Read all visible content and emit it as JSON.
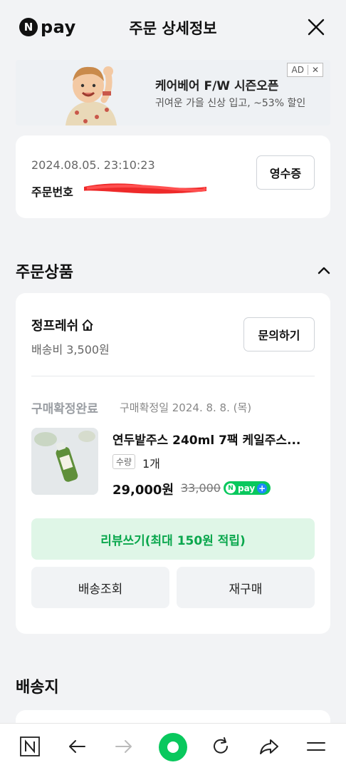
{
  "header": {
    "logo_letter": "N",
    "logo_text": "pay",
    "title": "주문 상세정보"
  },
  "ad": {
    "title": "케어베어 F/W 시즌오픈",
    "subtitle": "귀여운 가을 신상 입고, ~53% 할인",
    "badge": "AD",
    "close": "✕"
  },
  "order": {
    "datetime": "2024.08.05. 23:10:23",
    "number_label": "주문번호",
    "receipt_button": "영수증"
  },
  "ordered_section": {
    "title": "주문상품"
  },
  "seller": {
    "name": "정프레쉬",
    "shipping_fee": "배송비 3,500원",
    "inquiry_button": "문의하기"
  },
  "item": {
    "status": "구매확정완료",
    "status_date": "구매확정일 2024. 8. 8. (목)",
    "name": "연두밭주스 240ml 7팩 케일주스...",
    "qty_label": "수량",
    "qty": "1개",
    "price": "29,000원",
    "original_price": "33,000",
    "npay_badge": "pay",
    "npay_n": "N",
    "npay_plus": "+"
  },
  "actions": {
    "review": "리뷰쓰기(최대 150원 적립)",
    "track": "배송조회",
    "reorder": "재구매"
  },
  "delivery_section": {
    "title": "배송지"
  },
  "colors": {
    "accent_green": "#09c85d",
    "review_text": "#0aa74d",
    "review_bg": "#dff6e7"
  }
}
